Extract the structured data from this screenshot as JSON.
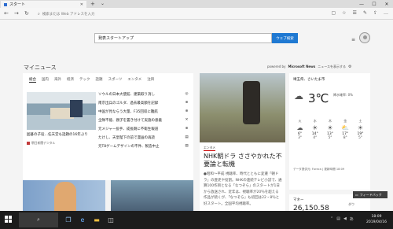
{
  "browser": {
    "tab_title": "スタート",
    "new_tab": "+",
    "url_placeholder": "検索または Web アドレスを入力"
  },
  "search": {
    "value": "発表スタートアップ",
    "button": "ウェブ検索"
  },
  "news": {
    "section_title": "マイニュース",
    "powered_prefix": "powered by",
    "powered_brand": "Microsoft News",
    "settings_link": "ニュースを表示する",
    "categories": [
      "総合",
      "国内",
      "海外",
      "経済",
      "テック",
      "話題",
      "スポーツ",
      "エンタメ",
      "注目"
    ],
    "main_caption": "囲碁の子役…任天堂も話題の16年ぶり",
    "main_source": "朝日新聞デジタル",
    "headlines": [
      {
        "text": "ソウルの日本大使館、建築取り消し",
        "logo": "◎"
      },
      {
        "text": "南京出兵のゴルダ、過去最高額を記録",
        "logo": "⊕"
      },
      {
        "text": "中国が見ならう大量、F35回収に難航",
        "logo": "⊕"
      },
      {
        "text": "全隊不能、親子を置き付けて実施の意義",
        "logo": "✕"
      },
      {
        "text": "元メジャー投手、成長期に不衛生報道",
        "logo": "⊕"
      },
      {
        "text": "たけし、天皇陛下の前で漫画の再読",
        "logo": "▤"
      },
      {
        "text": "元T8ゲームデザインの不件、製造中止",
        "logo": "▤"
      }
    ]
  },
  "featured": {
    "category": "エンタメ",
    "title": "NHK朝ドラ ささやかれた不要論と転機",
    "body": "●昭和〜平成 視聴率、時代とともに変遷「朝ドラ」の歴史や役割。NHKの連続テレビ小説で、通算100作目となる「なつぞら」のスタートが1日から放送され、近年は、視聴率が20％を超える作品が続くが、「なつぞら」も初回は22・8％と好スタート。全国平均視聴率。"
  },
  "weather": {
    "location": "埼玉県、さいたま市",
    "temp": "3℃",
    "precip": "降水確率: 0%",
    "forecast": [
      {
        "day": "火",
        "icon": "☁",
        "hi": "6°",
        "lo": "3°"
      },
      {
        "day": "水",
        "icon": "☀",
        "hi": "14°",
        "lo": "4°"
      },
      {
        "day": "木",
        "icon": "☀",
        "hi": "13°",
        "lo": "5°"
      },
      {
        "day": "金",
        "icon": "⛅",
        "hi": "17°",
        "lo": "8°"
      },
      {
        "day": "土",
        "icon": "☀",
        "hi": "19°",
        "lo": "5°"
      }
    ],
    "source": "データ提供元: Foreca | 更新時間 18:09"
  },
  "money": {
    "title": "マネー",
    "sub": "ダウ",
    "value": "26,150.58"
  },
  "feedback": {
    "label": "フィードバック"
  },
  "taskbar": {
    "time": "18:09",
    "date": "2019/04/16"
  },
  "colors": {
    "accent": "#1f79d2",
    "taskbar": "#1c1c1c"
  }
}
